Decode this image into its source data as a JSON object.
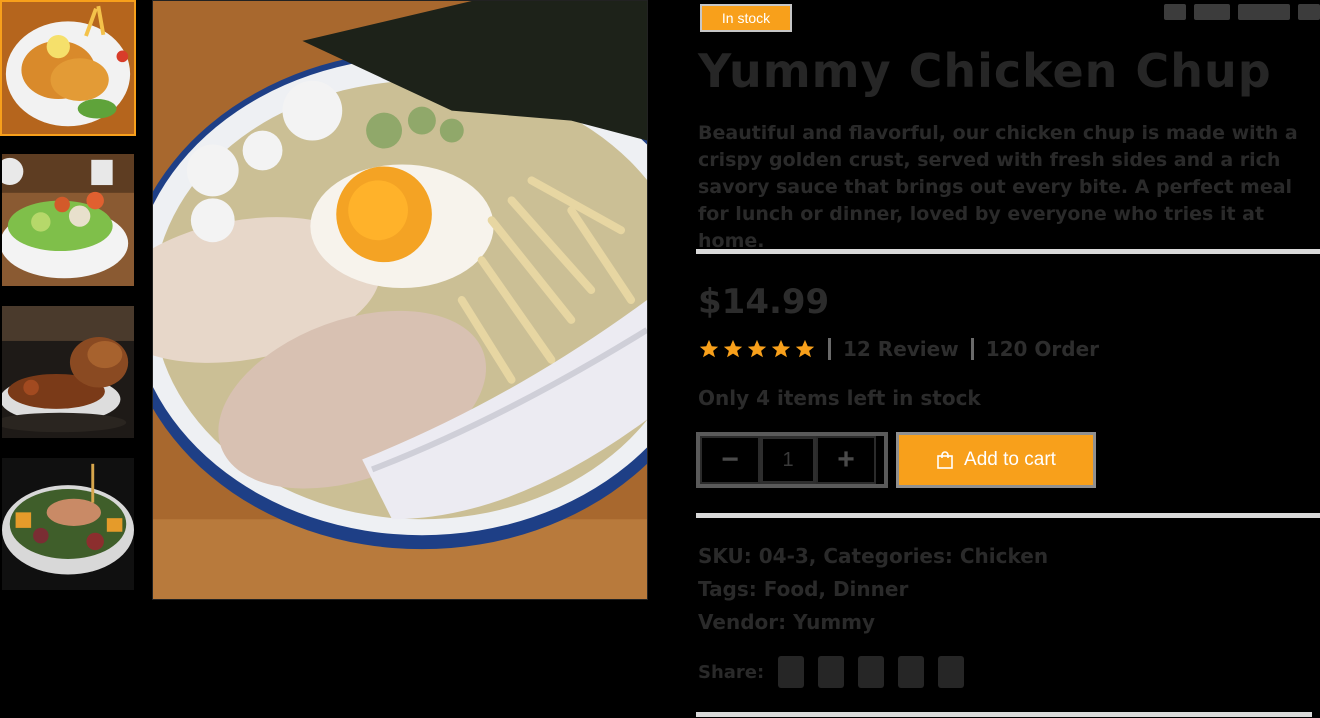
{
  "badge": {
    "label": "In stock"
  },
  "product": {
    "title": "Yummy Chicken Chup",
    "description": "Beautiful and flavorful, our chicken chup is made with a crispy golden crust, served with fresh sides and a rich savory sauce that brings out every bite. A perfect meal for lunch or dinner, loved by everyone who tries it at home.",
    "price": "$14.99",
    "rating": 5,
    "reviews": "12 Review",
    "orders": "120 Order",
    "availability": "Only 4 items left in stock"
  },
  "quantity": {
    "minus_label": "−",
    "value": "1",
    "plus_label": "+"
  },
  "cart": {
    "add_label": "Add to cart"
  },
  "meta": {
    "line1": "SKU: 04-3, Categories: Chicken",
    "line2": "Tags: Food, Dinner",
    "line3": "Vendor: Yummy",
    "share_label": "Share:"
  },
  "colors": {
    "accent": "#f8a01b"
  },
  "icons": {
    "thumb_1": "fried-chicken-plate",
    "thumb_2": "salad-bowl",
    "thumb_3": "roast-chicken-dish",
    "thumb_4": "meat-salad-bowl",
    "main": "ramen-bowl",
    "cart": "shopping-bag-icon",
    "star": "star-icon"
  }
}
